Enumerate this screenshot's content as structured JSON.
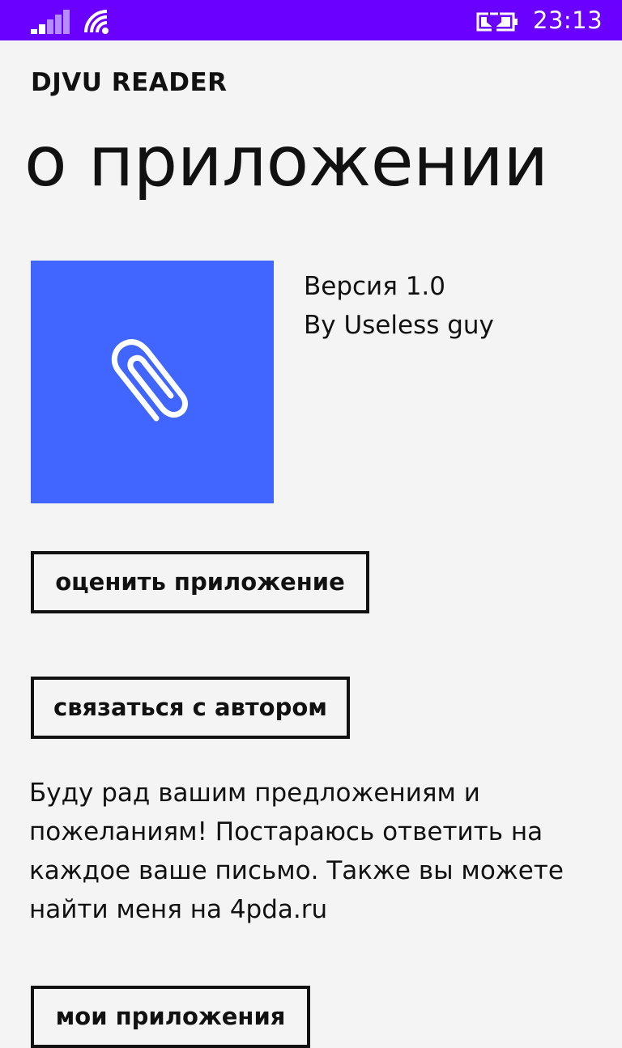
{
  "status_bar": {
    "time": "23:13",
    "icons": [
      "signal-icon",
      "wifi-icon",
      "battery-charging-icon"
    ],
    "color": "#6a00ff"
  },
  "header": {
    "app_title": "DJVU READER",
    "page_title": "о приложении"
  },
  "app_info": {
    "tile_icon": "paperclip-icon",
    "tile_color": "#4166ff",
    "version": "Версия 1.0",
    "author": "By Useless guy"
  },
  "buttons": {
    "rate": "оценить приложение",
    "contact": "связаться с автором",
    "my_apps": "мои приложения"
  },
  "description": "Буду рад вашим предложениям и пожеланиям! Постараюсь ответить на каждое ваше письмо. Также вы можете найти меня на 4pda.ru"
}
